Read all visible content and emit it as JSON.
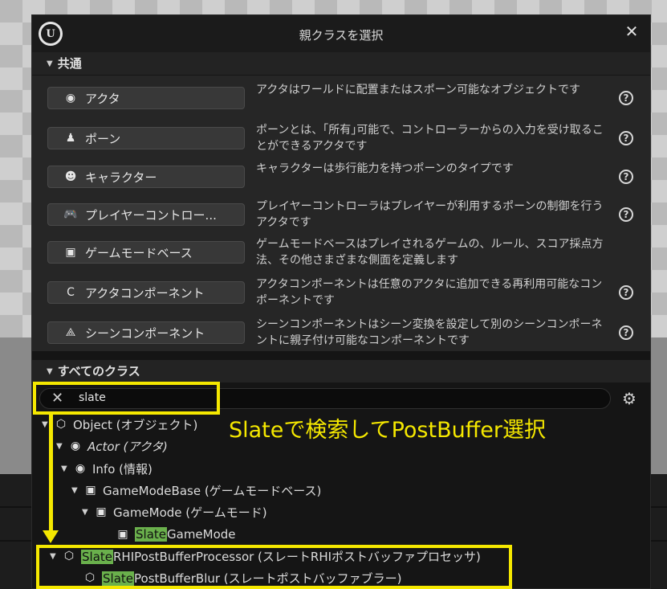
{
  "window": {
    "title": "親クラスを選択",
    "close_label": "✕",
    "logo_letter": "U"
  },
  "sections": {
    "common": "共通",
    "all_classes": "すべてのクラス"
  },
  "common_classes": [
    {
      "label": "アクタ",
      "icon": "actor-icon",
      "desc": "アクタはワールドに配置またはスポーン可能なオブジェクトです",
      "help": true
    },
    {
      "label": "ポーン",
      "icon": "pawn-icon",
      "desc": "ポーンとは、｢所有｣可能で、コントローラーからの入力を受け取ることができるアクタです",
      "help": true
    },
    {
      "label": "キャラクター",
      "icon": "character-icon",
      "desc": "キャラクターは歩行能力を持つポーンのタイプです",
      "help": true
    },
    {
      "label": "プレイヤーコントロー...",
      "icon": "gamepad-icon",
      "desc": "プレイヤーコントローラはプレイヤーが利用するポーンの制御を行うアクタです",
      "help": true
    },
    {
      "label": "ゲームモードベース",
      "icon": "gamemode-icon",
      "desc": "ゲームモードベースはプレイされるゲームの、ルール、スコア採点方法、その他さまざまな側面を定義します",
      "help": false
    },
    {
      "label": "アクタコンポーネント",
      "icon": "component-icon",
      "desc": "アクタコンポーネントは任意のアクタに追加できる再利用可能なコンポーネントです",
      "help": true
    },
    {
      "label": "シーンコンポーネント",
      "icon": "scene-component-icon",
      "desc": "シーンコンポーネントはシーン変換を設定して別のシーンコンポーネントに親子付け可能なコンポーネントです",
      "help": true
    }
  ],
  "search": {
    "value": "slate",
    "clear": "✕",
    "settings_icon": "gear-icon"
  },
  "tree": [
    {
      "pre": "",
      "hl": "",
      "post": "Object (オブジェクト)",
      "icon": "object-icon",
      "italic": false
    },
    {
      "pre": "",
      "hl": "",
      "post": "Actor (アクタ)",
      "icon": "actor-icon",
      "italic": true
    },
    {
      "pre": "",
      "hl": "",
      "post": "Info (情報)",
      "icon": "actor-icon",
      "italic": false
    },
    {
      "pre": "",
      "hl": "",
      "post": "GameModeBase (ゲームモードベース)",
      "icon": "gamemode-icon",
      "italic": false
    },
    {
      "pre": "",
      "hl": "",
      "post": "GameMode (ゲームモード)",
      "icon": "gamemode-icon",
      "italic": false
    },
    {
      "pre": "",
      "hl": "Slate",
      "post": "GameMode",
      "icon": "gamemode-icon",
      "italic": false
    },
    {
      "pre": "",
      "hl": "Slate",
      "post": "RHIPostBufferProcessor (スレートRHIポストバッファプロセッサ)",
      "icon": "object-icon",
      "italic": false
    },
    {
      "pre": "",
      "hl": "Slate",
      "post": "PostBufferBlur (スレートポストバッファブラー)",
      "icon": "object-icon",
      "italic": false
    }
  ],
  "annotation": {
    "text": "Slateで検索してPostBuffer選択"
  },
  "colors": {
    "highlight": "#6ab04c",
    "annotation": "#f5e800"
  }
}
